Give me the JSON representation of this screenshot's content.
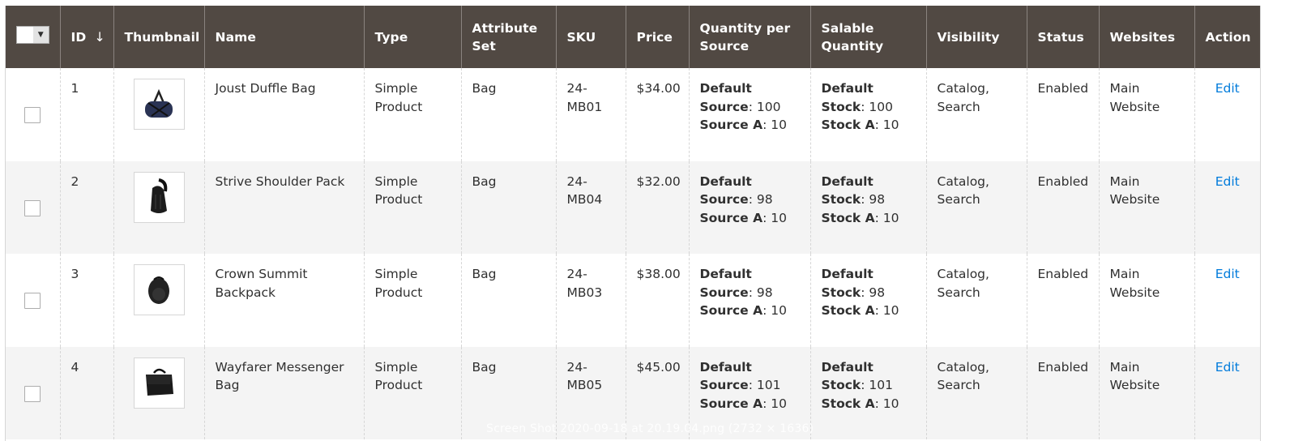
{
  "grid": {
    "columns": [
      {
        "key": "select",
        "label": ""
      },
      {
        "key": "id",
        "label": "ID",
        "sort": "desc-arrow"
      },
      {
        "key": "thumbnail",
        "label": "Thumbnail"
      },
      {
        "key": "name",
        "label": "Name"
      },
      {
        "key": "type",
        "label": "Type"
      },
      {
        "key": "attribute_set",
        "label": "Attribute Set"
      },
      {
        "key": "sku",
        "label": "SKU"
      },
      {
        "key": "price",
        "label": "Price"
      },
      {
        "key": "qty_per_source",
        "label": "Quantity per Source"
      },
      {
        "key": "salable_qty",
        "label": "Salable Quantity"
      },
      {
        "key": "visibility",
        "label": "Visibility"
      },
      {
        "key": "status",
        "label": "Status"
      },
      {
        "key": "websites",
        "label": "Websites"
      },
      {
        "key": "action",
        "label": "Action"
      }
    ],
    "sort_arrow": "↓",
    "mass_select_arrow": "▼",
    "rows": [
      {
        "id": "1",
        "thumbnail": "duffle-bag-image",
        "name": "Joust Duffle Bag",
        "type": "Simple Product",
        "attribute_set": "Bag",
        "sku": "24-MB01",
        "price": "$34.00",
        "qty_per_source": [
          {
            "label": "Default Source",
            "value": "100"
          },
          {
            "label": "Source A",
            "value": "10"
          }
        ],
        "salable_qty": [
          {
            "label": "Default Stock",
            "value": "100"
          },
          {
            "label": "Stock A",
            "value": "10"
          }
        ],
        "visibility": "Catalog, Search",
        "status": "Enabled",
        "websites": "Main Website",
        "action": "Edit"
      },
      {
        "id": "2",
        "thumbnail": "shoulder-pack-image",
        "name": "Strive Shoulder Pack",
        "type": "Simple Product",
        "attribute_set": "Bag",
        "sku": "24-MB04",
        "price": "$32.00",
        "qty_per_source": [
          {
            "label": "Default Source",
            "value": "98"
          },
          {
            "label": "Source A",
            "value": "10"
          }
        ],
        "salable_qty": [
          {
            "label": "Default Stock",
            "value": "98"
          },
          {
            "label": "Stock A",
            "value": "10"
          }
        ],
        "visibility": "Catalog, Search",
        "status": "Enabled",
        "websites": "Main Website",
        "action": "Edit"
      },
      {
        "id": "3",
        "thumbnail": "backpack-image",
        "name": "Crown Summit Backpack",
        "type": "Simple Product",
        "attribute_set": "Bag",
        "sku": "24-MB03",
        "price": "$38.00",
        "qty_per_source": [
          {
            "label": "Default Source",
            "value": "98"
          },
          {
            "label": "Source A",
            "value": "10"
          }
        ],
        "salable_qty": [
          {
            "label": "Default Stock",
            "value": "98"
          },
          {
            "label": "Stock A",
            "value": "10"
          }
        ],
        "visibility": "Catalog, Search",
        "status": "Enabled",
        "websites": "Main Website",
        "action": "Edit"
      },
      {
        "id": "4",
        "thumbnail": "messenger-bag-image",
        "name": "Wayfarer Messenger Bag",
        "type": "Simple Product",
        "attribute_set": "Bag",
        "sku": "24-MB05",
        "price": "$45.00",
        "qty_per_source": [
          {
            "label": "Default Source",
            "value": "101"
          },
          {
            "label": "Source A",
            "value": "10"
          }
        ],
        "salable_qty": [
          {
            "label": "Default Stock",
            "value": "101"
          },
          {
            "label": "Stock A",
            "value": "10"
          }
        ],
        "visibility": "Catalog, Search",
        "status": "Enabled",
        "websites": "Main Website",
        "action": "Edit"
      }
    ]
  },
  "colors": {
    "header_bg": "#514943",
    "row_alt_bg": "#f4f4f4",
    "link": "#007bdb"
  },
  "watermark": "Screen Shot 2020-09-18 at 20.19.04.png (2732 × 1636)"
}
